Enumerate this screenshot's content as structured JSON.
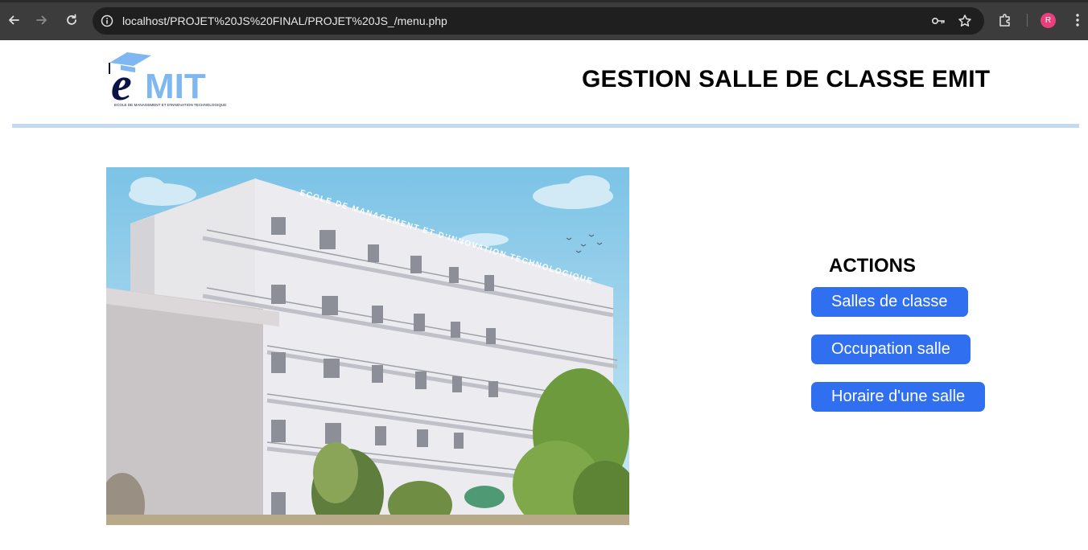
{
  "browser": {
    "url": "localhost/PROJET%20JS%20FINAL/PROJET%20JS_/menu.php",
    "profile_initial": "R"
  },
  "header": {
    "logo_wordmark": "eMIT",
    "logo_subtitle": "ECOLE DE MANAGEMENT ET D'INNOVATION TECHNOLOGIQUE",
    "title": "GESTION SALLE DE CLASSE EMIT"
  },
  "hero": {
    "building_sign": "ECOLE DE MANAGEMENT ET D'INNOVATION TECHNOLOGIQUE"
  },
  "actions": {
    "title": "ACTIONS",
    "buttons": [
      {
        "label": "Salles de classe"
      },
      {
        "label": "Occupation salle"
      },
      {
        "label": "Horaire d'une salle"
      }
    ]
  },
  "colors": {
    "accent_button": "#2f6ff0",
    "divider": "#c5d9f1",
    "logo_blue": "#7fb8f0",
    "logo_navy": "#0b1246"
  }
}
